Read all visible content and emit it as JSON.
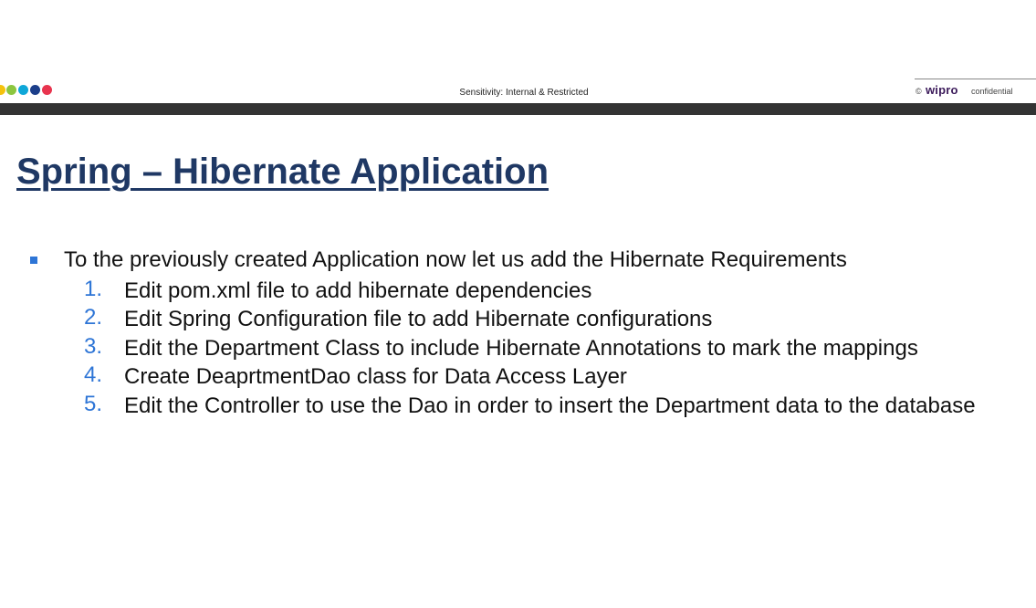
{
  "header": {
    "sensitivity": "Sensitivity: Internal & Restricted",
    "copyright": "©",
    "brand": "wipro",
    "confidential": "confidential",
    "dots": [
      {
        "name": "dot-yellow",
        "color": "#f4c20d"
      },
      {
        "name": "dot-green",
        "color": "#8cc63f"
      },
      {
        "name": "dot-cyan",
        "color": "#0fa7d8"
      },
      {
        "name": "dot-navy",
        "color": "#1c3e8a"
      },
      {
        "name": "dot-red",
        "color": "#e8344e"
      }
    ]
  },
  "slide": {
    "title": "Spring – Hibernate Application",
    "intro": "To the previously created Application now let us add the Hibernate Requirements",
    "steps": [
      {
        "num": "1.",
        "text": "Edit pom.xml file to add hibernate dependencies"
      },
      {
        "num": "2.",
        "text": "Edit Spring Configuration file to add Hibernate configurations"
      },
      {
        "num": "3.",
        "text": "Edit the Department Class to include Hibernate Annotations to mark the mappings"
      },
      {
        "num": "4.",
        "text": "Create DeaprtmentDao class for Data Access Layer"
      },
      {
        "num": "5.",
        "text": "Edit the Controller to use the Dao in order to insert the Department data to the database"
      }
    ]
  },
  "colors": {
    "title": "#1f3864",
    "accent": "#2e75d6",
    "bar": "#333333"
  }
}
